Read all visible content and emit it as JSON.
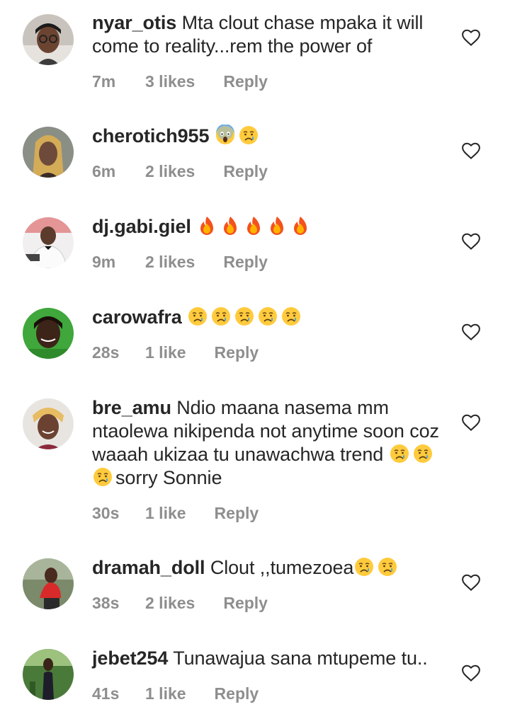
{
  "colors": {
    "text": "#262626",
    "muted": "#8e8e8e",
    "background": "#ffffff"
  },
  "comments": [
    {
      "username": "nyar_otis",
      "text": "Mta clout chase mpaka it will come to reality...rem the power of",
      "emojis": [],
      "time": "7m",
      "likes": "3 likes",
      "reply": "Reply",
      "avatar_icon": "avatar-woman-glasses"
    },
    {
      "username": "cherotich955",
      "text": "",
      "emojis": [
        "face-screaming-in-fear",
        "crying-face"
      ],
      "time": "6m",
      "likes": "2 likes",
      "reply": "Reply",
      "avatar_icon": "avatar-woman-braids"
    },
    {
      "username": "dj.gabi.giel",
      "text": "",
      "emojis": [
        "fire",
        "fire",
        "fire",
        "fire",
        "fire"
      ],
      "time": "9m",
      "likes": "2 likes",
      "reply": "Reply",
      "avatar_icon": "avatar-man-suit"
    },
    {
      "username": "carowafra",
      "text": "",
      "emojis": [
        "crying-face",
        "crying-face",
        "crying-face",
        "crying-face",
        "crying-face"
      ],
      "time": "28s",
      "likes": "1 like",
      "reply": "Reply",
      "avatar_icon": "avatar-woman-green"
    },
    {
      "username": "bre_amu",
      "text": "Ndio maana nasema mm ntaolewa nikipenda not anytime soon coz waaah ukizaa tu unawachwa trend",
      "emojis_after": [
        "crying-face",
        "crying-face",
        "crying-face"
      ],
      "text_after": "sorry Sonnie",
      "time": "30s",
      "likes": "1 like",
      "reply": "Reply",
      "avatar_icon": "avatar-woman-smile"
    },
    {
      "username": "dramah_doll",
      "text": "Clout ,,tumezoea",
      "emojis": [
        "crying-face",
        "crying-face"
      ],
      "time": "38s",
      "likes": "2 likes",
      "reply": "Reply",
      "avatar_icon": "avatar-woman-red"
    },
    {
      "username": "jebet254",
      "text": "Tunawajua sana mtupeme tu..",
      "emojis": [],
      "time": "41s",
      "likes": "1 like",
      "reply": "Reply",
      "avatar_icon": "avatar-woman-outdoor"
    }
  ]
}
